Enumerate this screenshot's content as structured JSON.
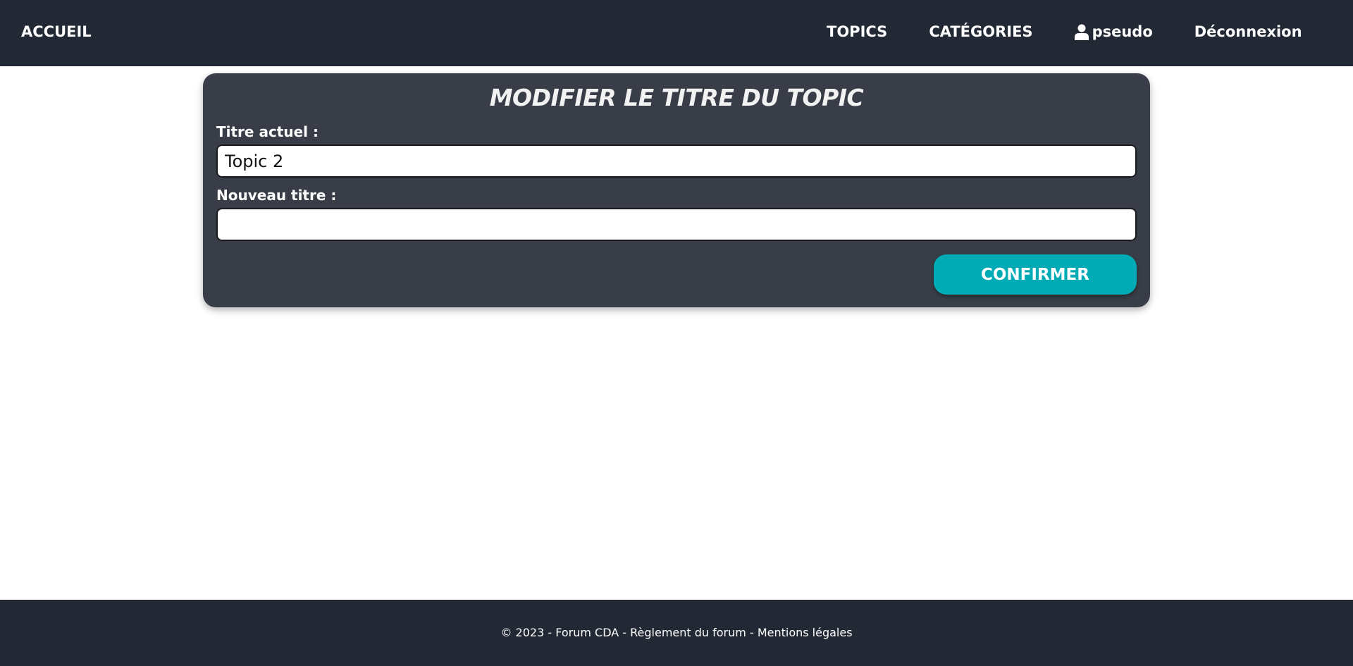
{
  "header": {
    "home_label": "ACCUEIL",
    "topics_label": "TOPICS",
    "categories_label": "CATÉGORIES",
    "user_label": "pseudo",
    "user_icon": "user-icon",
    "logout_label": "Déconnexion"
  },
  "form": {
    "title": "MODIFIER LE TITRE DU TOPIC",
    "current_label": "Titre actuel :",
    "current_value": "Topic 2",
    "new_label": "Nouveau titre :",
    "new_value": "",
    "confirm_label": "CONFIRMER"
  },
  "footer": {
    "copyright": "© 2023 - Forum CDA - ",
    "rules_link": "Règlement du forum",
    "separator": " - ",
    "legal_link": "Mentions légales"
  },
  "colors": {
    "nav_background": "#222834",
    "card_background": "#393d47",
    "accent": "#00abb5"
  }
}
